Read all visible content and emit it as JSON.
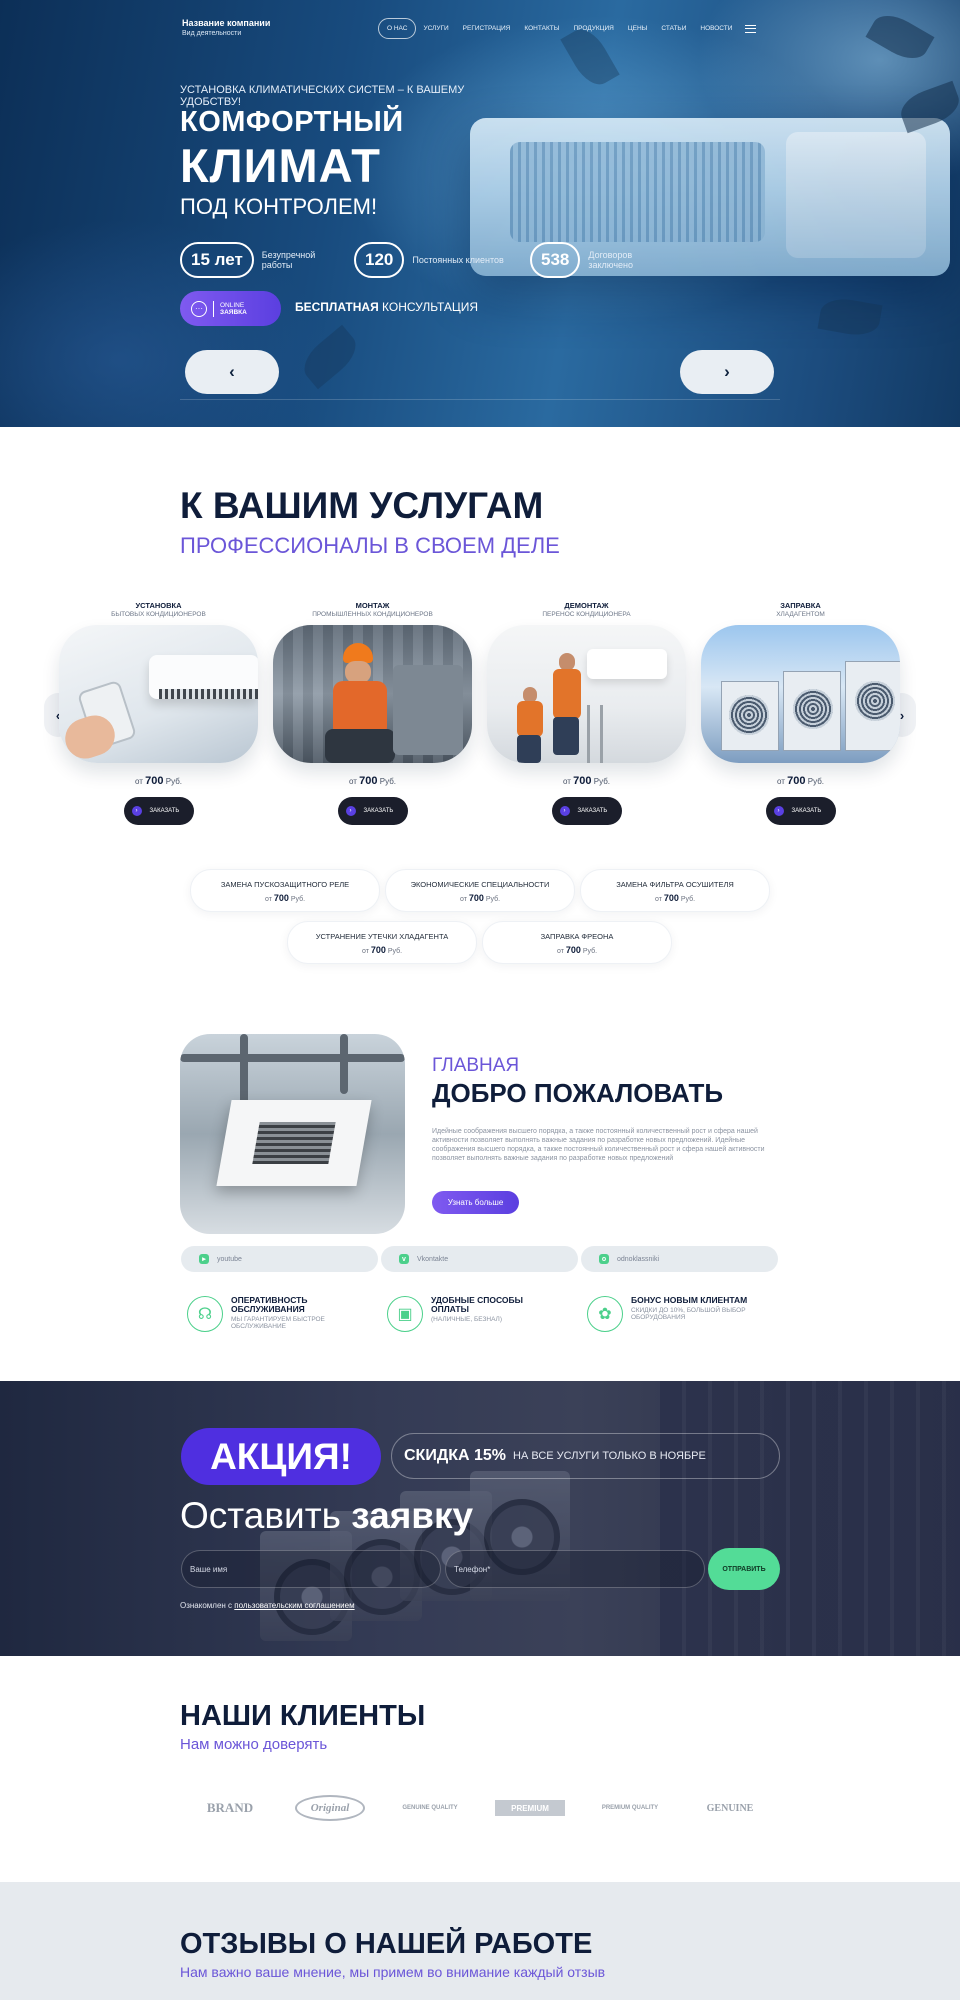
{
  "header": {
    "company_name": "Название компании",
    "company_sub": "Вид деятельности",
    "nav": [
      "О НАС",
      "УСЛУГИ",
      "РЕГИСТРАЦИЯ",
      "КОНТАКТЫ",
      "ПРОДУКЦИЯ",
      "ЦЕНЫ",
      "СТАТЬИ",
      "НОВОСТИ"
    ]
  },
  "hero": {
    "tagline": "УСТАНОВКА КЛИМАТИЧЕСКИХ СИСТЕМ – К ВАШЕМУ УДОБСТВУ!",
    "title_line1": "КОМФОРТНЫЙ",
    "title_line2": "КЛИМАТ",
    "title_line3": "ПОД КОНТРОЛЕМ!",
    "stats": [
      {
        "value": "15 лет",
        "label": "Безупречной работы"
      },
      {
        "value": "120",
        "label": "Постоянных клиентов"
      },
      {
        "value": "538",
        "label": "Договоров заключено"
      }
    ],
    "online_top": "ONLINE",
    "online_bottom": "ЗАЯВКА",
    "free_bold": "БЕСПЛАТНАЯ",
    "free_rest": "КОНСУЛЬТАЦИЯ",
    "arrow_prev": "‹",
    "arrow_next": "›"
  },
  "services": {
    "title": "К ВАШИМ УСЛУГАМ",
    "subtitle": "ПРОФЕССИОНАЛЫ В СВОЕМ ДЕЛЕ",
    "cards": [
      {
        "title": "УСТАНОВКА",
        "sub": "БЫТОВЫХ КОНДИЦИОНЕРОВ",
        "price_from": "от",
        "price": "700",
        "currency": "Руб.",
        "button": "ЗАКАЗАТЬ"
      },
      {
        "title": "МОНТАЖ",
        "sub": "ПРОМЫШЛЕННЫХ КОНДИЦИОНЕРОВ",
        "price_from": "от",
        "price": "700",
        "currency": "Руб.",
        "button": "ЗАКАЗАТЬ"
      },
      {
        "title": "ДЕМОНТАЖ",
        "sub": "ПЕРЕНОС КОНДИЦИОНЕРА",
        "price_from": "от",
        "price": "700",
        "currency": "Руб.",
        "button": "ЗАКАЗАТЬ"
      },
      {
        "title": "ЗАПРАВКА",
        "sub": "ХЛАДАГЕНТОМ",
        "price_from": "от",
        "price": "700",
        "currency": "Руб.",
        "button": "ЗАКАЗАТЬ"
      }
    ],
    "extra": [
      {
        "name": "ЗАМЕНА ПУСКОЗАЩИТНОГО РЕЛЕ",
        "price_from": "от",
        "price": "700",
        "currency": "Руб."
      },
      {
        "name": "ЭКОНОМИЧЕСКИЕ СПЕЦИАЛЬНОСТИ",
        "price_from": "от",
        "price": "700",
        "currency": "Руб."
      },
      {
        "name": "ЗАМЕНА ФИЛЬТРА ОСУШИТЕЛЯ",
        "price_from": "от",
        "price": "700",
        "currency": "Руб."
      },
      {
        "name": "УСТРАНЕНИЕ УТЕЧКИ ХЛАДАГЕНТА",
        "price_from": "от",
        "price": "700",
        "currency": "Руб."
      },
      {
        "name": "ЗАПРАВКА ФРЕОНА",
        "price_from": "от",
        "price": "700",
        "currency": "Руб."
      }
    ]
  },
  "welcome": {
    "kicker": "ГЛАВНАЯ",
    "title": "ДОБРО ПОЖАЛОВАТЬ",
    "text": "Идейные соображения высшего порядка, а также постоянный количественный рост и сфера нашей активности позволяет выполнять важные задания по разработке новых предложений. Идейные соображения высшего порядка, а также постоянный количественный рост и сфера нашей активности позволяет выполнять важные задания по разработке новых предложений",
    "button": "Узнать больше",
    "socials": [
      "youtube",
      "Vkontakte",
      "odnoklassniki"
    ],
    "features": [
      {
        "title": "ОПЕРАТИВНОСТЬ ОБСЛУЖИВАНИЯ",
        "sub": "МЫ ГАРАНТИРУЕМ БЫСТРОЕ ОБСЛУЖИВАНИЕ"
      },
      {
        "title": "УДОБНЫЕ СПОСОБЫ ОПЛАТЫ",
        "sub": "(НАЛИЧНЫЕ, БЕЗНАЛ)"
      },
      {
        "title": "БОНУС НОВЫМ КЛИЕНТАМ",
        "sub": "СКИДКИ ДО 10%, БОЛЬШОЙ ВЫБОР ОБОРУДОВАНИЯ"
      }
    ]
  },
  "promo": {
    "badge": "АКЦИЯ!",
    "discount_bold": "СКИДКА 15%",
    "discount_text": "НА ВСЕ УСЛУГИ ТОЛЬКО В НОЯБРЕ",
    "leave_light": "Оставить",
    "leave_bold": "заявку",
    "name_placeholder": "Ваше имя",
    "phone_placeholder": "Телефон*",
    "send": "ОТПРАВИТЬ",
    "agree_text": "Ознакомлен с",
    "agree_link": "пользовательским соглашением"
  },
  "clients": {
    "title": "НАШИ КЛИЕНТЫ",
    "subtitle": "Нам можно доверять",
    "logos": [
      "BRAND",
      "Original",
      "GENUINE QUALITY",
      "PREMIUM",
      "PREMIUM QUALITY",
      "GENUINE"
    ]
  },
  "reviews": {
    "title": "ОТЗЫВЫ О НАШЕЙ РАБОТЕ",
    "subtitle": "Нам важно ваше мнение, мы примем во внимание каждый отзыв"
  },
  "colors": {
    "accent": "#5b3fe0",
    "navy": "#0f1d3a",
    "green": "#53dc97",
    "promo_bg": "#343b55"
  }
}
